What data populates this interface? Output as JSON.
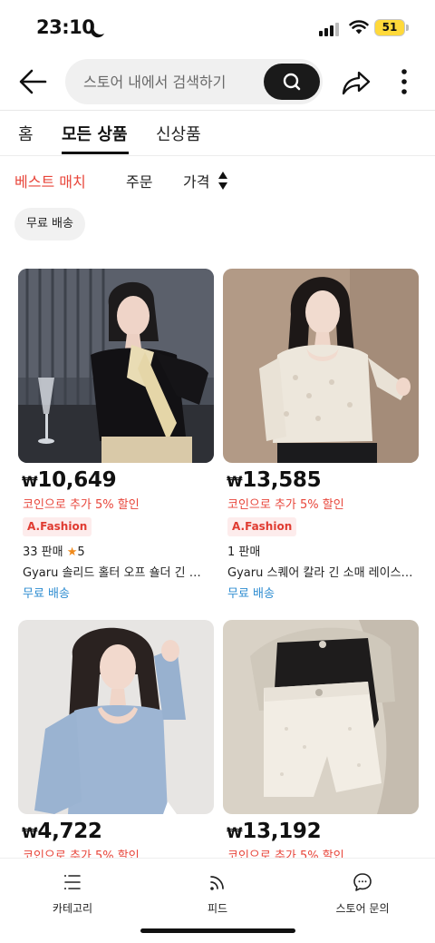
{
  "status_bar": {
    "time": "23:10",
    "battery": "51"
  },
  "header": {
    "search_placeholder": "스토어 내에서 검색하기"
  },
  "tabs": [
    {
      "label": "홈"
    },
    {
      "label": "모든 상품",
      "active": true
    },
    {
      "label": "신상품"
    }
  ],
  "sort": {
    "best_match": "베스트 매치",
    "orders": "주문",
    "price": "가격"
  },
  "filters": {
    "free_shipping_chip": "무료 배송"
  },
  "products": [
    {
      "price_symbol": "₩",
      "price": "10,649",
      "coin_note": "코인으로 추가 5% 할인",
      "store": "A.Fashion",
      "sales": "33 판매",
      "rating": "5",
      "title": "Gyaru 솔리드 홀터 오프 숄더 긴 소매 리본",
      "shipping": "무료 배송"
    },
    {
      "price_symbol": "₩",
      "price": "13,585",
      "coin_note": "코인으로 추가 5% 할인",
      "store": "A.Fashion",
      "sales": "1 판매",
      "title": "Gyaru 스퀘어 칼라 긴 소매 레이스 상의",
      "shipping": "무료 배송"
    },
    {
      "price_symbol": "₩",
      "price": "4,722",
      "coin_note": "코인으로 추가 5% 할인"
    },
    {
      "price_symbol": "₩",
      "price": "13,192",
      "coin_note": "코인으로 추가 5% 할인"
    }
  ],
  "bottom_nav": [
    {
      "label": "카테고리",
      "icon": "category-list-icon"
    },
    {
      "label": "피드",
      "icon": "feed-icon"
    },
    {
      "label": "스토어 문의",
      "icon": "chat-bubble-icon"
    }
  ],
  "colors": {
    "accent_red": "#e8463b",
    "link_blue": "#2f8dd1",
    "badge_bg": "#fdecec",
    "star_orange": "#f08a1c"
  }
}
